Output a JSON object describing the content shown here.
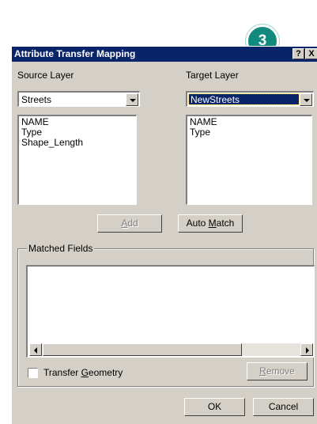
{
  "callout": {
    "number": "3"
  },
  "dialog": {
    "title": "Attribute Transfer Mapping",
    "help_button": "?",
    "close_button": "X"
  },
  "source": {
    "label": "Source Layer",
    "selected": "Streets",
    "fields": [
      "NAME",
      "Type",
      "Shape_Length"
    ]
  },
  "target": {
    "label": "Target Layer",
    "selected": "NewStreets",
    "fields": [
      "NAME",
      "Type"
    ]
  },
  "buttons": {
    "add": {
      "label": "Add",
      "accel": "A",
      "rest": "dd"
    },
    "auto_match": {
      "pre": "Auto ",
      "accel": "M",
      "rest": "atch"
    },
    "remove": {
      "accel": "R",
      "rest": "emove"
    },
    "ok": "OK",
    "cancel": "Cancel"
  },
  "matched": {
    "legend": "Matched Fields"
  },
  "transfer_geometry": {
    "pre": "Transfer ",
    "accel": "G",
    "rest": "eometry",
    "checked": false
  }
}
